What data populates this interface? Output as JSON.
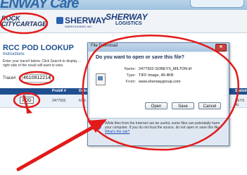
{
  "header": {
    "brand_partial": "ENWAY Care",
    "logos": {
      "rock": [
        "ROCK",
        "CITYCARTAGE"
      ],
      "sherway_warehousing": [
        "SHERWAY",
        "WAREHOUSING INC."
      ],
      "sherway_logistics": [
        "SHERWAY",
        "LOGISTICS"
      ]
    }
  },
  "page": {
    "title": "RCC POD LOOKUP",
    "subtitle": "Instructions",
    "instructions": "Enter your trace# below. Click Search to display ... right side of the result will want to view.",
    "trace_label": "Trace#",
    "trace_value": "4610812214"
  },
  "table": {
    "headers": [
      "",
      "Probill #",
      "Deliv"
    ],
    "right_header": "Statistic",
    "row": {
      "pod_button": "POD",
      "probill": "2477932",
      "deliv": "6/16",
      "right_cell": "SEYS AL"
    }
  },
  "dialog": {
    "title": "File Download",
    "close_glyph": "✕",
    "question": "Do you want to open or save this file?",
    "name_label": "Name:",
    "name_value": "2477932-SOBEYS_MILTON.tif",
    "type_label": "Type:",
    "type_value": "TIFF Image, 49.4KB",
    "from_label": "From:",
    "from_value": "www.sherwaygroup.com",
    "buttons": {
      "open": "Open",
      "save": "Save",
      "cancel": "Cancel"
    },
    "warning": "While files from the Internet can be useful, some files can potentially harm your computer. If you do not trust the source, do not open or save this file.",
    "warning_link": "What's the risk?"
  },
  "annotation_color": "#e21a1a",
  "icons": {
    "file": "file-icon",
    "warning": "shield-question-icon",
    "close": "close-icon"
  }
}
